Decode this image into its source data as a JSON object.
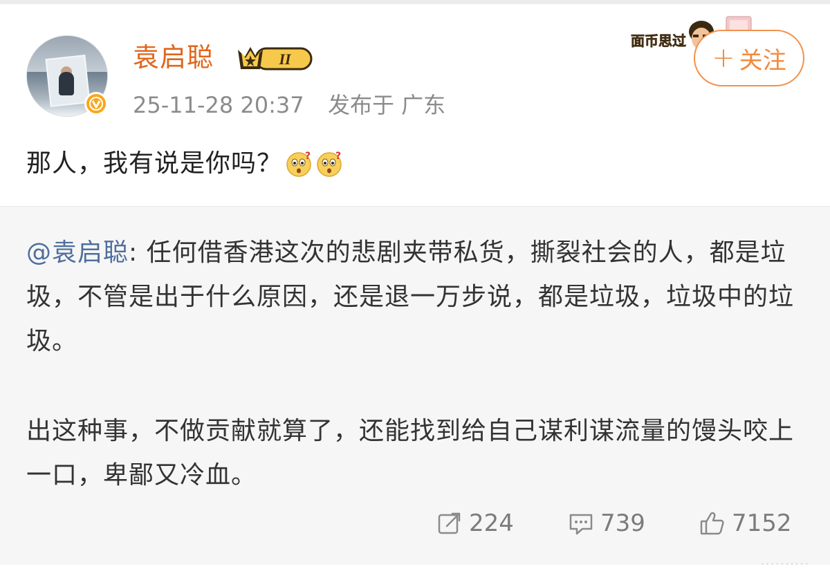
{
  "post": {
    "author": "袁启聪",
    "level_badge": "II",
    "timestamp": "25-11-28 20:37",
    "location_prefix": "发布于",
    "location": "广东",
    "text": "那人，我有说是你吗？",
    "emoji_icons": [
      "shocked-face-emoji",
      "shocked-face-emoji"
    ],
    "follow_label": "关注",
    "sticker_text": "面币思过"
  },
  "repost": {
    "mention": "@袁启聪",
    "separator": ": ",
    "paragraph1": "任何借香港这次的悲剧夹带私货，撕裂社会的人，都是垃圾，不管是出于什么原因，还是退一万步说，都是垃圾，垃圾中的垃圾。",
    "paragraph2": "出这种事，不做贡献就算了，还能找到给自己谋利谋流量的馒头咬上一口，卑鄙又冷血。"
  },
  "actions": {
    "repost_count": "224",
    "comment_count": "739",
    "like_count": "7152"
  },
  "colors": {
    "author": "#e0651a",
    "follow": "#f28a3c",
    "mention": "#4e6e9d",
    "repost_bg": "#f6f6f6",
    "meta": "#8b8b8b"
  }
}
